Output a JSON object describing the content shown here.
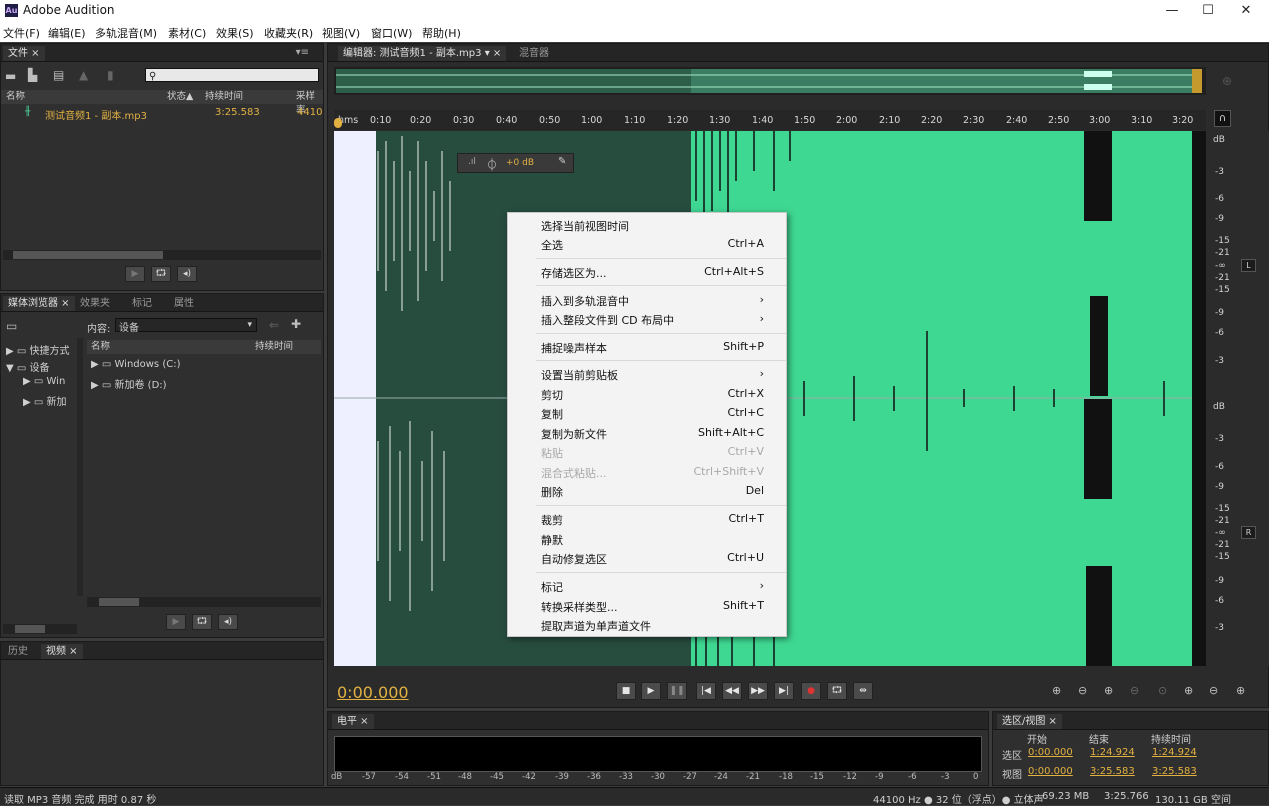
{
  "app": {
    "icon_text": "Au",
    "title": "Adobe Audition"
  },
  "window_controls": {
    "minimize": "—",
    "maximize": "☐",
    "close": "✕"
  },
  "menu": [
    "文件(F)",
    "编辑(E)",
    "多轨混音(M)",
    "素材(C)",
    "效果(S)",
    "收藏夹(R)",
    "视图(V)",
    "窗口(W)",
    "帮助(H)"
  ],
  "files_panel": {
    "tab": "文件",
    "columns": {
      "name": "名称",
      "status": "状态▲",
      "duration": "持续时间",
      "rate": "采样率"
    },
    "file": {
      "name": "测试音频1 - 副本.mp3",
      "duration": "3:25.583",
      "rate": "4410"
    }
  },
  "media_panel": {
    "tabs": [
      "媒体浏览器",
      "效果夹",
      "标记",
      "属性"
    ],
    "content_label": "内容:",
    "content_value": "设备",
    "tree": [
      "快捷方式",
      "设备",
      "Win",
      "新加"
    ],
    "columns": {
      "name": "名称",
      "duration": "持续时间"
    },
    "items": [
      "Windows (C:)",
      "新加卷 (D:)"
    ]
  },
  "history_panel": {
    "tabs": [
      "历史",
      "视频"
    ]
  },
  "editor": {
    "tab": "编辑器: 测试音频1 - 副本.mp3",
    "tab2": "混音器",
    "ruler_unit": "hms",
    "ruler_ticks": [
      "0:10",
      "0:20",
      "0:30",
      "0:40",
      "0:50",
      "1:00",
      "1:10",
      "1:20",
      "1:30",
      "1:40",
      "1:50",
      "2:00",
      "2:10",
      "2:20",
      "2:30",
      "2:40",
      "2:50",
      "3:00",
      "3:10",
      "3:20"
    ],
    "hud_gain": "+0 dB",
    "db_top": [
      "dB",
      "-3",
      "-6",
      "-9",
      "-15",
      "-21",
      "-∞",
      "-21",
      "-15",
      "-9",
      "-6",
      "-3"
    ],
    "db_bottom": [
      "dB",
      "-3",
      "-6",
      "-9",
      "-15",
      "-21",
      "-∞",
      "-21",
      "-15",
      "-9",
      "-6",
      "-3"
    ],
    "channel_left": "L",
    "channel_right": "R",
    "time": "0:00.000"
  },
  "context_menu": [
    {
      "label": "选择当前视图时间",
      "shortcut": ""
    },
    {
      "label": "全选",
      "shortcut": "Ctrl+A"
    },
    {
      "label": "存储选区为...",
      "shortcut": "Ctrl+Alt+S"
    },
    {
      "label": "插入到多轨混音中",
      "shortcut": "›"
    },
    {
      "label": "插入整段文件到 CD 布局中",
      "shortcut": "›"
    },
    {
      "label": "捕捉噪声样本",
      "shortcut": "Shift+P"
    },
    {
      "label": "设置当前剪贴板",
      "shortcut": "›"
    },
    {
      "label": "剪切",
      "shortcut": "Ctrl+X"
    },
    {
      "label": "复制",
      "shortcut": "Ctrl+C"
    },
    {
      "label": "复制为新文件",
      "shortcut": "Shift+Alt+C"
    },
    {
      "label": "粘贴",
      "shortcut": "Ctrl+V"
    },
    {
      "label": "混合式粘贴...",
      "shortcut": "Ctrl+Shift+V"
    },
    {
      "label": "删除",
      "shortcut": "Del"
    },
    {
      "label": "裁剪",
      "shortcut": "Ctrl+T"
    },
    {
      "label": "静默",
      "shortcut": ""
    },
    {
      "label": "自动修复选区",
      "shortcut": "Ctrl+U"
    },
    {
      "label": "标记",
      "shortcut": "›"
    },
    {
      "label": "转换采样类型...",
      "shortcut": "Shift+T"
    },
    {
      "label": "提取声道为单声道文件",
      "shortcut": ""
    }
  ],
  "level_panel": {
    "tab": "电平",
    "scale": [
      "dB",
      "-57",
      "-54",
      "-51",
      "-48",
      "-45",
      "-42",
      "-39",
      "-36",
      "-33",
      "-30",
      "-27",
      "-24",
      "-21",
      "-18",
      "-15",
      "-12",
      "-9",
      "-6",
      "-3",
      "0"
    ]
  },
  "selection_panel": {
    "tab": "选区/视图",
    "cols": [
      "开始",
      "结束",
      "持续时间"
    ],
    "sel_label": "选区",
    "sel": [
      "0:00.000",
      "1:24.924",
      "1:24.924"
    ],
    "view_label": "视图",
    "view": [
      "0:00.000",
      "3:25.583",
      "3:25.583"
    ]
  },
  "status": {
    "left": "读取 MP3 音频 完成 用时 0.87 秒",
    "rate": "44100 Hz ● 32 位（浮点）● 立体声",
    "size": "69.23 MB",
    "duration": "3:25.766",
    "free": "130.11 GB 空间"
  },
  "colors": {
    "wave_selected": "#274d3f",
    "wave_unselected": "#3fd893",
    "accent": "#e2b142"
  }
}
